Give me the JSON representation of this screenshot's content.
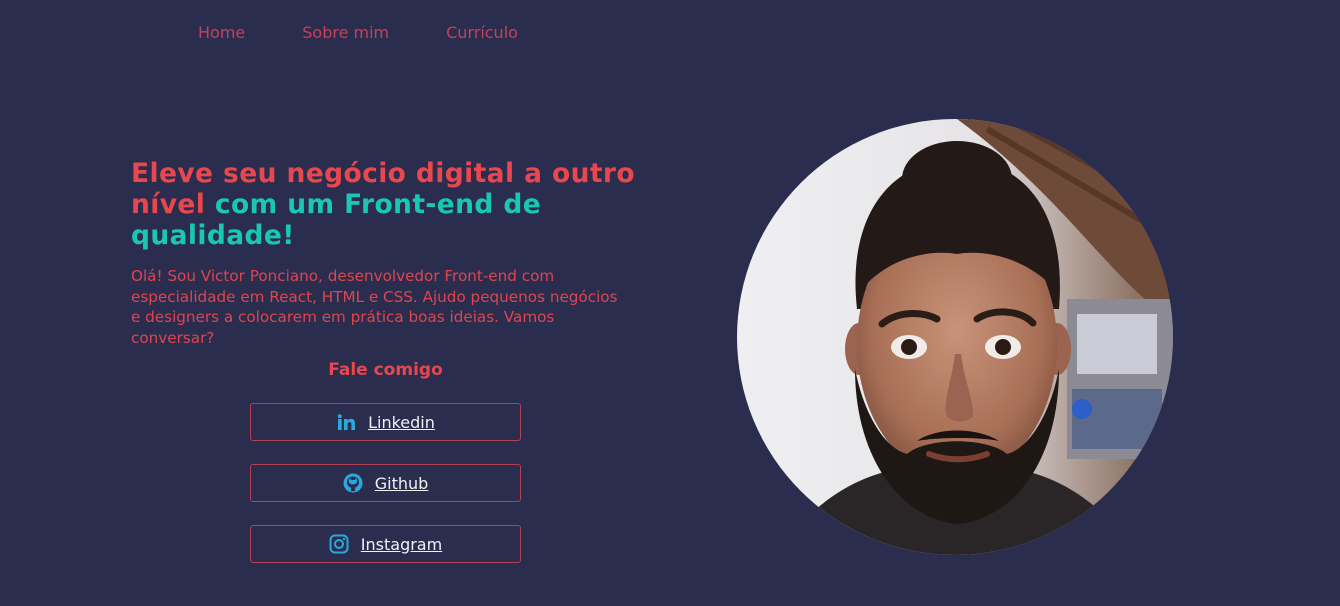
{
  "nav": {
    "items": [
      {
        "label": "Home"
      },
      {
        "label": "Sobre mim"
      },
      {
        "label": "Currículo"
      }
    ]
  },
  "hero": {
    "title_part_red": "Eleve seu negócio digital a outro nível",
    "title_part_teal": "com um Front-end de qualidade!",
    "description": "Olá! Sou Victor Ponciano, desenvolvedor Front-end com especialidade em React, HTML e CSS. Ajudo pequenos negócios e designers a colocarem em prática boas ideias. Vamos conversar?"
  },
  "contact": {
    "heading": "Fale comigo",
    "buttons": [
      {
        "label": "Linkedin",
        "icon": "linkedin-icon"
      },
      {
        "label": "Github",
        "icon": "github-icon"
      },
      {
        "label": "Instagram",
        "icon": "instagram-icon"
      }
    ]
  },
  "colors": {
    "background": "#2b2d4e",
    "accent_red": "#e8474d",
    "accent_teal": "#19c8b4",
    "nav_link": "#c8405a",
    "icon_blue": "#29a8e0"
  }
}
